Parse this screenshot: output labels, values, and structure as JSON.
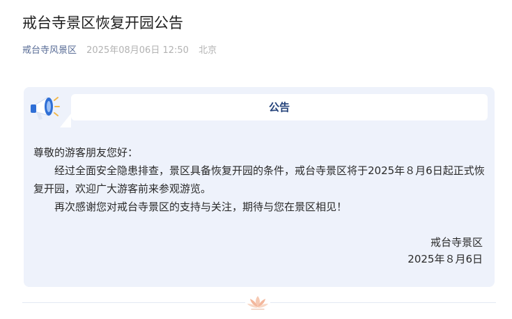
{
  "article": {
    "title": "戒台寺景区恢复开园公告",
    "source": "戒台寺风景区",
    "datetime": "2025年08月06日 12:50",
    "location": "北京"
  },
  "notice": {
    "label": "公告",
    "greeting": "尊敬的游客朋友您好：",
    "paragraph1": "经过全面安全隐患排查，景区具备恢复开园的条件，戒台寺景区将于2025年８月6日起正式恢复开园，欢迎广大游客前来参观游览。",
    "paragraph2": "再次感谢您对戒台寺景区的支持与关注，期待与您在景区相见！",
    "signature_org": "戒台寺景区",
    "signature_date": "2025年８月6日"
  },
  "icons": {
    "megaphone": "megaphone-icon",
    "lotus": "lotus-icon"
  },
  "colors": {
    "source_link": "#576b95",
    "card_background": "#eef2fb",
    "notice_label": "#24427a",
    "megaphone_blue": "#2f6fd6"
  }
}
